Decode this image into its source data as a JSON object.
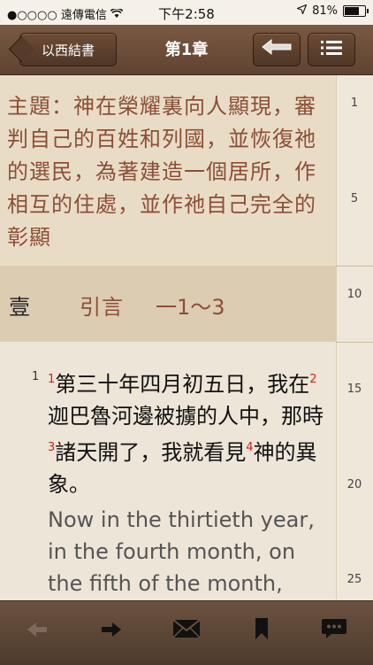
{
  "status_bar": {
    "carrier": "●○○○○ 遠傳電信 ",
    "wifi": "wifi-icon",
    "time": "下午2:58",
    "location": "location-arrow-icon",
    "battery_percent": "81%",
    "battery_level": 0.81
  },
  "nav": {
    "back_label": "以西結書",
    "title": "第1章",
    "history_icon": "back-arrow-icon",
    "list_icon": "list-icon"
  },
  "summary": {
    "text": "主題：神在榮耀裏向人顯現，審判自己的百姓和列國，並恢復祂的選民，為著建造一個居所，作相互的住處，並作祂自己完全的彰顯"
  },
  "outline": {
    "number": "壹",
    "title": "引言",
    "range": "一1～3"
  },
  "verse": {
    "number": "1",
    "segments": [
      {
        "fn": "1",
        "text": "第三十年四月初五日，我在"
      },
      {
        "fn": "2",
        "text": "迦巴魯河邊被擄的人中，那時"
      },
      {
        "fn": "3",
        "text": "諸天開了，我就看見"
      },
      {
        "fn": "4",
        "text": "神的異象。"
      }
    ],
    "english": "Now in the thirtieth year, in the fourth month, on the fifth of the month,"
  },
  "line_numbers": [
    "1",
    "5",
    "10",
    "15",
    "20",
    "25"
  ],
  "toolbar": {
    "prev_icon": "left-arrow-icon",
    "next_icon": "right-arrow-icon",
    "mail_icon": "envelope-icon",
    "bookmark_icon": "bookmark-icon",
    "comment_icon": "speech-bubble-icon"
  }
}
